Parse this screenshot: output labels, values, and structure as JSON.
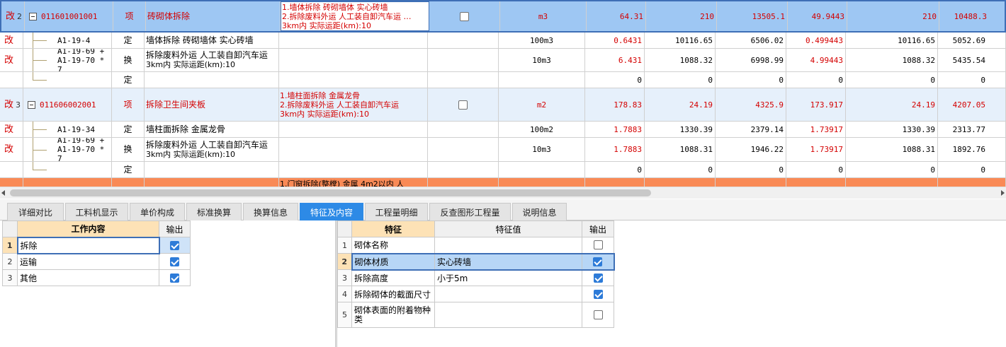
{
  "grid": {
    "rows": [
      {
        "mark": "改",
        "num": "2",
        "code": "011601001001",
        "type": "项",
        "name": "砖砌体拆除",
        "feat": [
          "1.墙体拆除 砖砌墙体 实心砖墙",
          "2.拆除废料外运 人工装自卸汽车运 …",
          "3km内  实际运距(km):10"
        ],
        "unit": "m3",
        "n1": "64.31",
        "n2": "210",
        "n3": "13505.1",
        "n4": "49.9443",
        "n5": "210",
        "n6": "10488.3"
      },
      {
        "mark": "改",
        "code": "A1-19-4",
        "type": "定",
        "name": "墙体拆除 砖砌墙体 实心砖墙",
        "unit": "100m3",
        "n1": "0.6431",
        "n2": "10116.65",
        "n3": "6506.02",
        "n4": "0.499443",
        "n5": "10116.65",
        "n6": "5052.69"
      },
      {
        "mark": "改",
        "code": [
          "A1-19-69 +",
          "A1-19-70 * 7"
        ],
        "type": "换",
        "name": [
          "拆除废料外运 人工装自卸汽车运",
          "3km内   实际运距(km):10"
        ],
        "unit": "10m3",
        "n1": "6.431",
        "n2": "1088.32",
        "n3": "6998.99",
        "n4": "4.99443",
        "n5": "1088.32",
        "n6": "5435.54"
      },
      {
        "mark": "",
        "code": "",
        "type": "定",
        "name": "",
        "unit": "",
        "n1": "0",
        "n2": "0",
        "n3": "0",
        "n4": "0",
        "n5": "0",
        "n6": "0"
      },
      {
        "mark": "改",
        "num": "3",
        "code": "011606002001",
        "type": "项",
        "name": "拆除卫生间夹板",
        "feat": [
          "1.墙柱面拆除 金属龙骨",
          "2.拆除废料外运 人工装自卸汽车运",
          "3km内  实际运距(km):10"
        ],
        "unit": "m2",
        "n1": "178.83",
        "n2": "24.19",
        "n3": "4325.9",
        "n4": "173.917",
        "n5": "24.19",
        "n6": "4207.05"
      },
      {
        "mark": "改",
        "code": "A1-19-34",
        "type": "定",
        "name": "墙柱面拆除 金属龙骨",
        "unit": "100m2",
        "n1": "1.7883",
        "n2": "1330.39",
        "n3": "2379.14",
        "n4": "1.73917",
        "n5": "1330.39",
        "n6": "2313.77"
      },
      {
        "mark": "改",
        "code": [
          "A1-19-69 +",
          "A1-19-70 * 7"
        ],
        "type": "换",
        "name": [
          "拆除废料外运 人工装自卸汽车运",
          "3km内   实际运距(km):10"
        ],
        "unit": "10m3",
        "n1": "1.7883",
        "n2": "1088.31",
        "n3": "1946.22",
        "n4": "1.73917",
        "n5": "1088.31",
        "n6": "1892.76"
      },
      {
        "mark": "",
        "code": "",
        "type": "定",
        "name": "",
        "unit": "",
        "n1": "0",
        "n2": "0",
        "n3": "0",
        "n4": "0",
        "n5": "0",
        "n6": "0"
      },
      {
        "feat_partial": "1.门窗拆除(整樘) 金属  4m2以内 人"
      }
    ]
  },
  "tabs": [
    "详细对比",
    "工料机显示",
    "单价构成",
    "标准换算",
    "换算信息",
    "特征及内容",
    "工程量明细",
    "反查图形工程量",
    "说明信息"
  ],
  "active_tab": "特征及内容",
  "work": {
    "headers": {
      "content": "工作内容",
      "output": "输出"
    },
    "rows": [
      {
        "num": "1",
        "text": "拆除",
        "checked": true
      },
      {
        "num": "2",
        "text": "运输",
        "checked": true
      },
      {
        "num": "3",
        "text": "其他",
        "checked": true
      }
    ]
  },
  "features": {
    "headers": {
      "feature": "特征",
      "value": "特征值",
      "output": "输出"
    },
    "rows": [
      {
        "num": "1",
        "name": "砌体名称",
        "value": "",
        "checked": false
      },
      {
        "num": "2",
        "name": "砌体材质",
        "value": "实心砖墙",
        "checked": true
      },
      {
        "num": "3",
        "name": "拆除高度",
        "value": "小于5m",
        "checked": true
      },
      {
        "num": "4",
        "name": "拆除砌体的截面尺寸",
        "value": "",
        "checked": true
      },
      {
        "num": "5",
        "name": "砌体表面的附着物种类",
        "value": "",
        "checked": false
      }
    ]
  },
  "colors": {
    "accent": "#2d8ae6",
    "mark_red": "#d40000",
    "selected_row": "#9ec7f3",
    "orange_row": "#f98a56"
  }
}
